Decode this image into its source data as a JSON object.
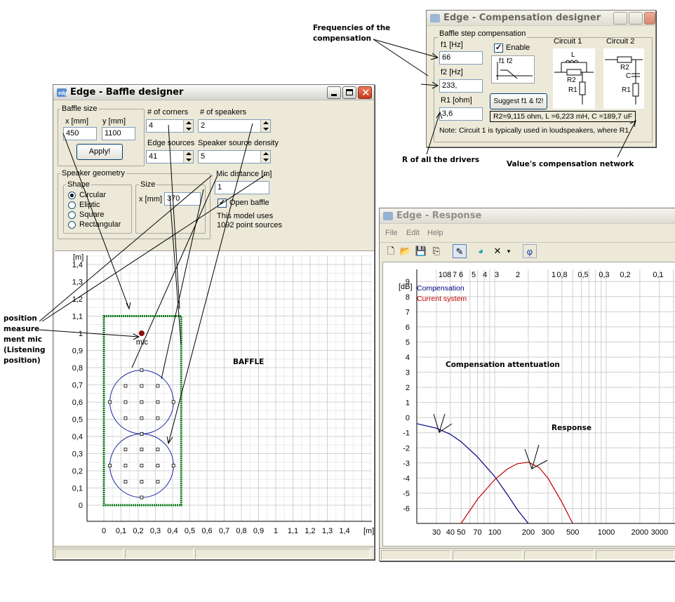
{
  "baffle_window": {
    "title": "Edge - Baffle designer",
    "baffle_size": {
      "group_label": "Baffle size",
      "x_label": "x [mm]",
      "x_value": "450",
      "y_label": "y [mm]",
      "y_value": "1100",
      "apply_label": "Apply!"
    },
    "corners": {
      "label": "# of corners",
      "value": "4"
    },
    "speakers": {
      "label": "# of speakers",
      "value": "2"
    },
    "edge_sources": {
      "label": "Edge sources",
      "value": "41"
    },
    "speaker_density": {
      "label": "Speaker source density",
      "value": "5"
    },
    "speaker_geometry": {
      "group_label": "Speaker geometry",
      "shape_label": "Shape",
      "shapes": [
        "Circular",
        "Eliptic",
        "Square",
        "Rectangular"
      ],
      "selected": "Circular",
      "size_label": "Size",
      "size_x_label": "x [mm]",
      "size_x_value": "370"
    },
    "mic_distance": {
      "label": "Mic distance [m]",
      "value": "1"
    },
    "open_baffle_label": "Open baffle",
    "info_line1": "This model uses",
    "info_line2": "1092 point sources",
    "plot": {
      "y_unit": "[m]",
      "x_unit": "[m]",
      "y_ticks": [
        "0",
        "0,1",
        "0,2",
        "0,3",
        "0,4",
        "0,5",
        "0,6",
        "0,7",
        "0,8",
        "0,9",
        "1",
        "1,1",
        "1,2",
        "1,3",
        "1,4"
      ],
      "x_ticks": [
        "0",
        "0,1",
        "0,2",
        "0,3",
        "0,4",
        "0,5",
        "0,6",
        "0,7",
        "0,8",
        "0,9",
        "1",
        "1,1",
        "1,2",
        "1,3",
        "1,4"
      ],
      "mic_label": "mic",
      "baffle_w_m": 0.45,
      "baffle_h_m": 1.1,
      "speaker1_center": [
        0.22,
        0.6
      ],
      "speaker2_center": [
        0.22,
        0.23
      ],
      "speaker_radius_m": 0.185,
      "mic_pos": [
        0.22,
        1.0
      ]
    }
  },
  "compensation_window": {
    "title": "Edge - Compensation designer",
    "group_label": "Baffle step compensation",
    "f1_label": "f1 [Hz]",
    "f1_value": "66",
    "f2_label": "f2 [Hz]",
    "f2_value": "233,",
    "r1_label": "R1 [ohm]",
    "r1_value": "3,6",
    "enable_label": "Enable",
    "f1f2_label": "f1 f2",
    "suggest_label": "Suggest f1 & f2!",
    "circuit1_label": "Circuit 1",
    "circuit2_label": "Circuit 2",
    "values_text": "R2=9,115 ohm, L =6,223 mH, C =189,7 uF",
    "note_text": "Note: Circuit 1 is typically used in loudspeakers, where R1",
    "component_L": "L",
    "component_R1": "R1",
    "component_R2": "R2",
    "component_C": "C"
  },
  "response_window": {
    "title": "Edge - Response",
    "menu": [
      "File",
      "Edit",
      "Help"
    ],
    "phi_label": "φ",
    "legend": [
      "Compensation",
      "Current system"
    ],
    "colors": {
      "compensation": "#000080",
      "current": "#c00000"
    }
  },
  "chart_data": {
    "type": "line",
    "title": "",
    "xlabel": "",
    "ylabel": "[dB]",
    "x_scale": "log",
    "xlim": [
      20,
      5000
    ],
    "ylim": [
      -7,
      10
    ],
    "x_ticks": [
      "30",
      "40",
      "50",
      "70",
      "100",
      "200",
      "300",
      "500",
      "1000",
      "2000",
      "3000",
      "500"
    ],
    "y_ticks": [
      "9",
      "8",
      "7",
      "6",
      "5",
      "4",
      "3",
      "2",
      "1",
      "0",
      "-1",
      "-2",
      "-3",
      "-4",
      "-5",
      "-6"
    ],
    "top_ticks": [
      "10",
      "8",
      "7",
      "6",
      "5",
      "4",
      "3",
      "2",
      "1",
      "0,8",
      "0,5",
      "0,3",
      "0,2",
      "0,1"
    ],
    "grid": true,
    "legend_position": "top-left",
    "series": [
      {
        "name": "Compensation",
        "x": [
          20,
          30,
          40,
          50,
          70,
          100,
          130,
          160,
          200
        ],
        "y": [
          -0.4,
          -0.7,
          -1.1,
          -1.6,
          -2.6,
          -3.9,
          -5.1,
          -6.1,
          -7.0
        ]
      },
      {
        "name": "Current system",
        "x": [
          50,
          70,
          100,
          130,
          160,
          200,
          250,
          300,
          400,
          500
        ],
        "y": [
          -7.0,
          -5.4,
          -4.1,
          -3.4,
          -3.05,
          -2.95,
          -3.3,
          -4.0,
          -5.6,
          -7.0
        ]
      }
    ]
  },
  "annotations": {
    "freq": [
      "Frequencies of the",
      "compensation"
    ],
    "r_all": "R of all the drivers",
    "values_net": "Value's compensation network",
    "position": [
      "position",
      "measure",
      "ment mic",
      "(Listening",
      "position)"
    ],
    "baffle": "BAFFLE",
    "comp_att": "Compensation attentuation",
    "response": "Response"
  }
}
